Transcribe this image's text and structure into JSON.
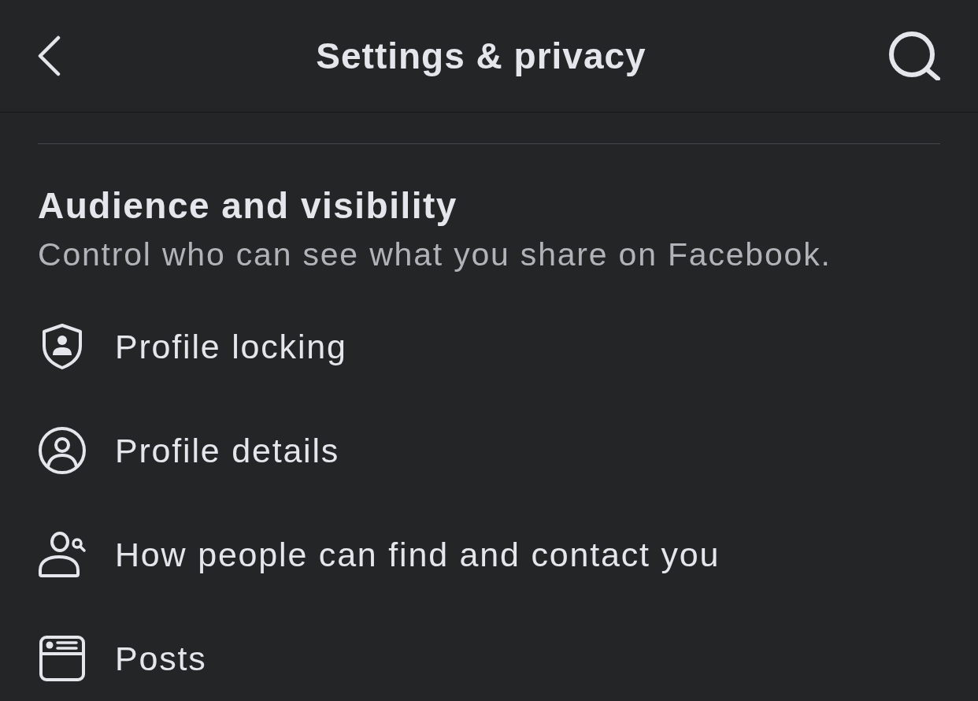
{
  "header": {
    "title": "Settings & privacy"
  },
  "section": {
    "title": "Audience and visibility",
    "subtitle": "Control who can see what you share on Facebook."
  },
  "items": [
    {
      "kind": "shield",
      "label": "Profile locking"
    },
    {
      "kind": "profile",
      "label": "Profile details"
    },
    {
      "kind": "people-search",
      "label": "How people can find and contact you"
    },
    {
      "kind": "posts",
      "label": "Posts"
    }
  ]
}
